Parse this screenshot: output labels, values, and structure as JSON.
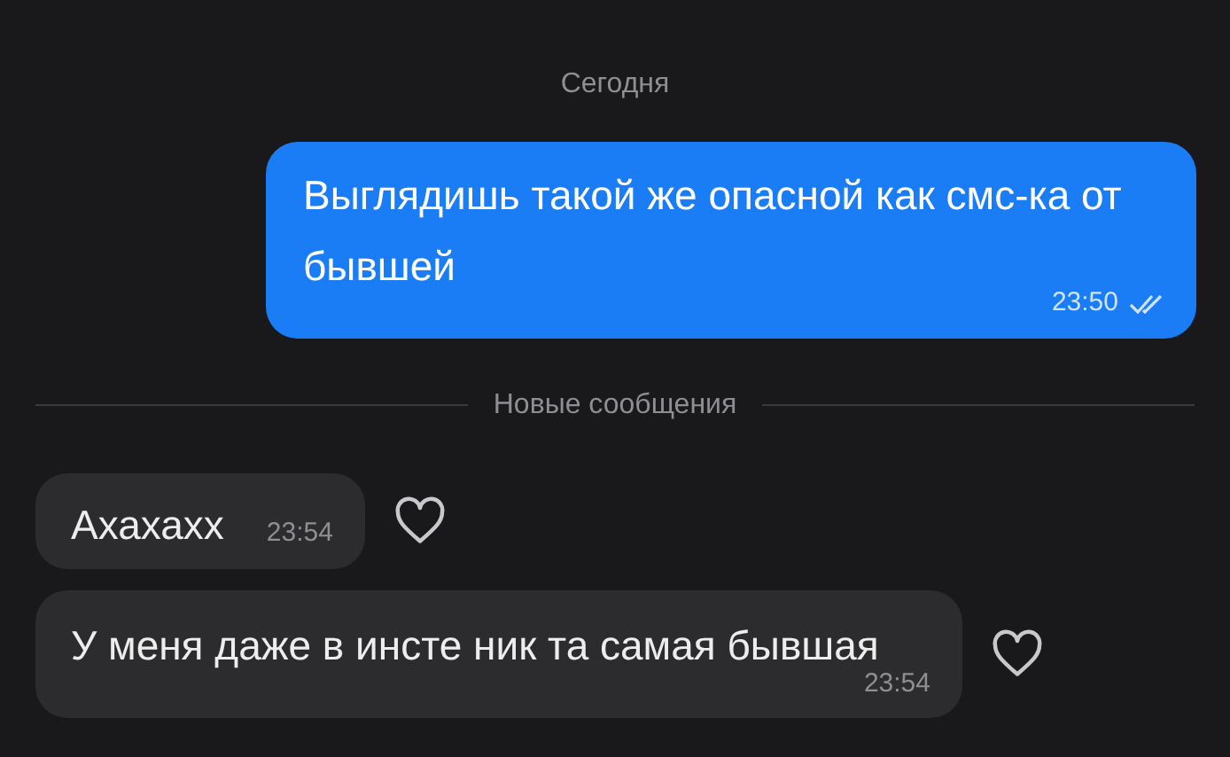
{
  "date_separator": "Сегодня",
  "messages_before": [
    {
      "kind": "outgoing",
      "text": "Выглядишь такой же опасной как смс-ка от бывшей",
      "time": "23:50",
      "read": true
    }
  ],
  "new_messages_divider": "Новые сообщения",
  "messages_after": [
    {
      "kind": "incoming",
      "text": "Ахахахх",
      "time": "23:54",
      "liked": false
    },
    {
      "kind": "incoming",
      "text": "У меня даже в инсте ник та самая бывшая",
      "time": "23:54",
      "liked": false
    }
  ]
}
